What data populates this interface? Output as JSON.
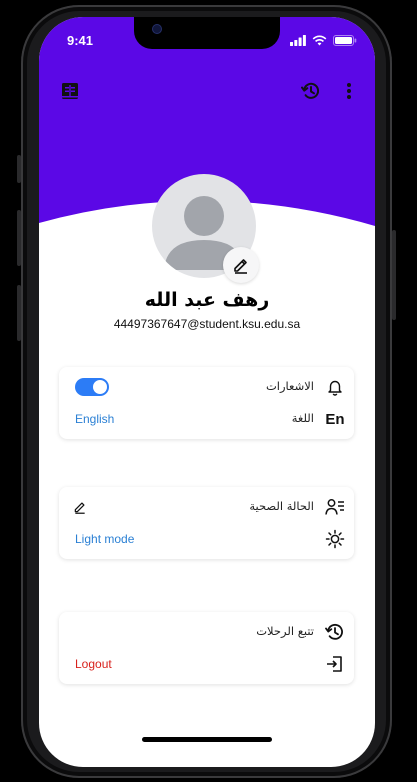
{
  "status_bar": {
    "time": "9:41"
  },
  "colors": {
    "header": "#5b08e6",
    "toggle_on": "#2c7cf6",
    "link_blue": "#2b80d4",
    "logout_red": "#d8221d"
  },
  "app_bar": {
    "left_icon": "book-icon",
    "right_icons": [
      "history-icon",
      "more-vertical-icon"
    ]
  },
  "profile": {
    "name": "رهف عبد الله",
    "email": "44497367647@student.ksu.edu.sa",
    "avatar_icon": "person-placeholder-icon",
    "edit_icon": "pencil-icon"
  },
  "settings_card_1": {
    "notifications": {
      "label": "الاشعارات",
      "icon": "bell-icon",
      "enabled": true
    },
    "language": {
      "label": "اللغة",
      "icon": "language-en-icon",
      "icon_text": "En",
      "value": "English"
    }
  },
  "settings_card_2": {
    "health_status": {
      "label": "الحالة الصحية",
      "icon": "person-list-icon",
      "action_icon": "pencil-icon"
    },
    "theme": {
      "icon": "sun-icon",
      "value": "Light mode"
    }
  },
  "settings_card_3": {
    "trip_tracking": {
      "label": "تتبع الرحلات",
      "icon": "history-icon"
    },
    "logout": {
      "icon": "logout-icon",
      "value": "Logout"
    }
  }
}
